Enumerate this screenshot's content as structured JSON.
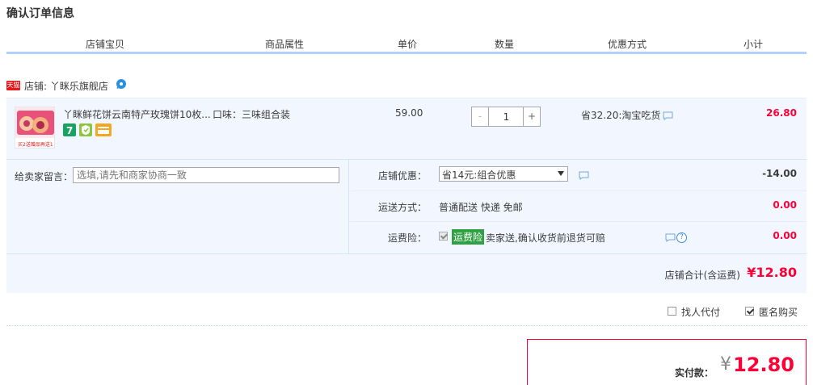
{
  "page": {
    "title": "确认订单信息"
  },
  "columns": [
    "店铺宝贝",
    "商品属性",
    "单价",
    "数量",
    "优惠方式",
    "小计"
  ],
  "shop": {
    "badge": "天猫",
    "label": "店铺: 丫眯乐旗舰店"
  },
  "item": {
    "title": "丫眯鲜花饼云南特产玫瑰饼10枚...",
    "attr": "口味：三味组合装",
    "price": "59.00",
    "quantity": "1",
    "minus": "-",
    "plus": "+",
    "promo": "省32.20:淘宝吃货",
    "subtotal": "26.80",
    "thumb_caption": "买2送赠品再送1",
    "service_icons": [
      "seven-day-return-icon",
      "guarantee-icon",
      "credit-card-icon"
    ]
  },
  "memo": {
    "label": "给卖家留言：",
    "placeholder": "选填,请先和商家协商一致"
  },
  "shop_discount": {
    "label": "店铺优惠：",
    "selected": "省14元:组合优惠",
    "amount": "-14.00"
  },
  "shipping": {
    "label": "运送方式：",
    "value": "普通配送 快递 免邮",
    "amount": "0.00"
  },
  "insurance": {
    "label": "运费险：",
    "tag": "运费险",
    "desc": "卖家送,确认收货前退货可赔",
    "amount": "0.00"
  },
  "shop_total": {
    "label": "店铺合计(含运费)",
    "value": "¥12.80"
  },
  "options": {
    "proxy_pay": "找人代付",
    "anonymous": "匿名购买"
  },
  "payment": {
    "label": "实付款：",
    "currency": "¥",
    "value": "12.80"
  },
  "colors": {
    "accent_red": "#ff0036",
    "header_line": "#b2d1ff",
    "row_bg": "#f2f7ff",
    "insurance_green": "#2fa143"
  }
}
